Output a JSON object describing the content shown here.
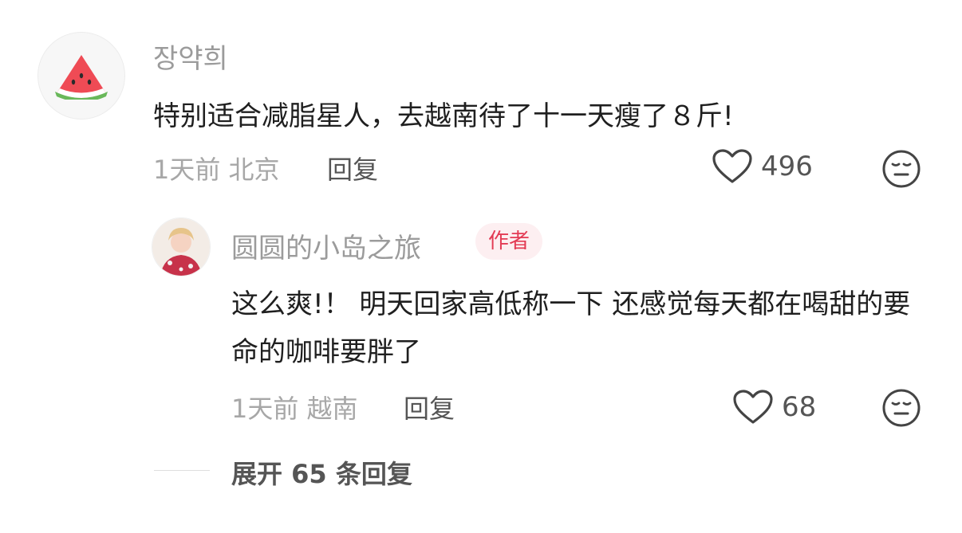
{
  "comment": {
    "username": "장약희",
    "text": "特别适合减脂星人，去越南待了十一天瘦了８斤!",
    "time": "1天前",
    "location": "北京",
    "reply_label": "回复",
    "like_count": "496",
    "avatar_icon": "watermelon-icon"
  },
  "reply": {
    "username": "圆圆的小岛之旅",
    "badge": "作者",
    "text": "这么爽!！ 明天回家高低称一下 还感觉每天都在喝甜的要命的咖啡要胖了",
    "time": "1天前",
    "location": "越南",
    "reply_label": "回复",
    "like_count": "68"
  },
  "expand": {
    "label": "展开 65 条回复"
  },
  "colors": {
    "badge_text": "#e33b54",
    "badge_bg": "#fdeff1",
    "muted": "#a7a7a7"
  }
}
